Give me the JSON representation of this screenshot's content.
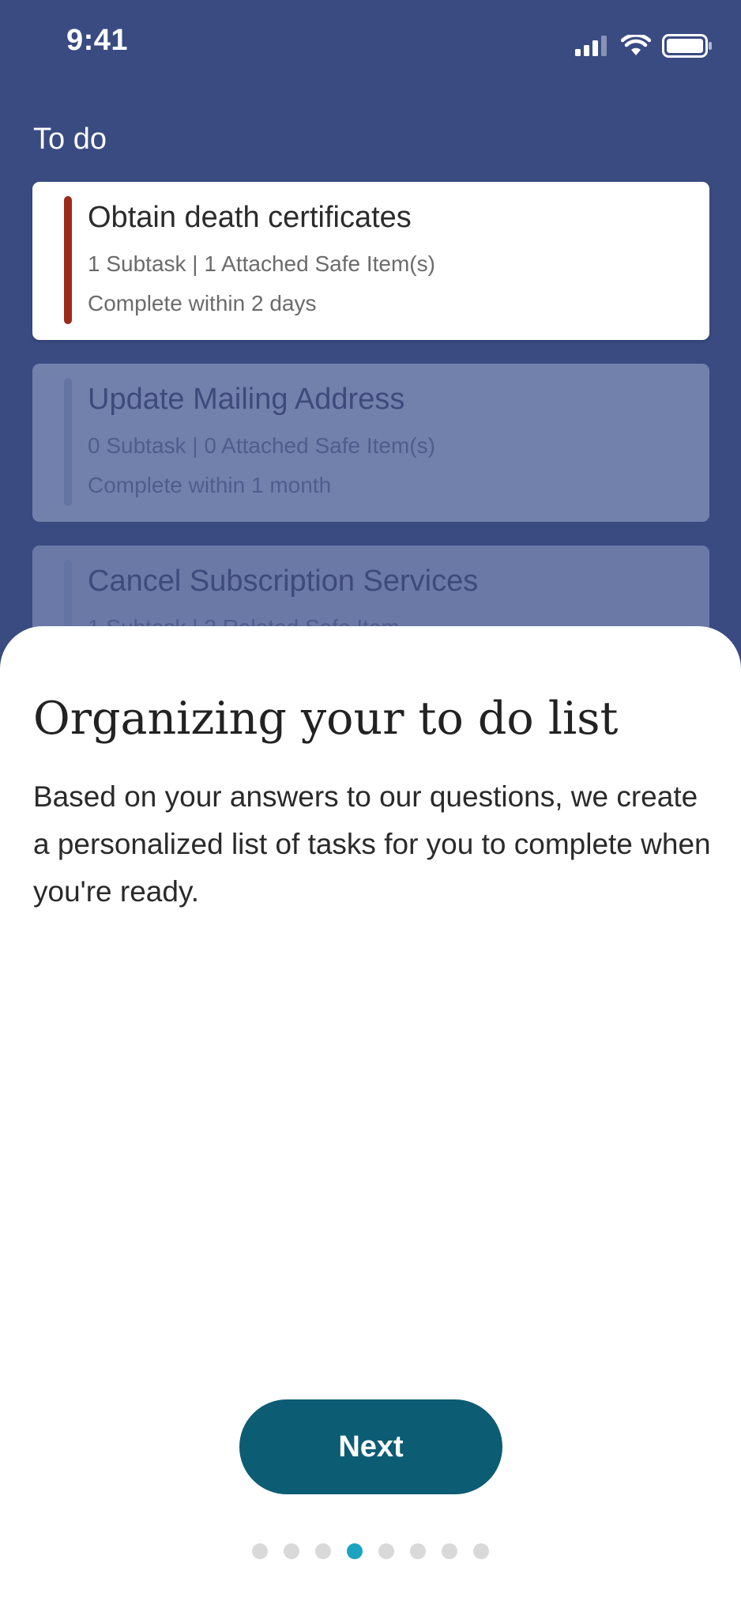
{
  "status_bar": {
    "time": "9:41"
  },
  "section": {
    "title": "To do"
  },
  "tasks": [
    {
      "title": "Obtain death certificates",
      "meta": "1 Subtask | 1 Attached Safe Item(s)",
      "due": "Complete within 2 days",
      "priority_color": "#9b2a1f"
    },
    {
      "title": "Update Mailing Address",
      "meta": "0 Subtask | 0 Attached Safe Item(s)",
      "due": "Complete within 1 month"
    },
    {
      "title": "Cancel Subscription Services",
      "meta": "1 Subtask | 2 Related Safe Item"
    }
  ],
  "onboarding": {
    "title": "Organizing your to do list",
    "body": "Based on your answers to our questions, we create a personalized list of tasks for you to complete when you're ready.",
    "next_label": "Next",
    "page_count": 8,
    "current_page": 4
  },
  "colors": {
    "header_bg": "#3a4b82",
    "button_bg": "#0c5c74",
    "pager_active": "#1ba3c0",
    "pager_inactive": "#d9d9d9"
  }
}
